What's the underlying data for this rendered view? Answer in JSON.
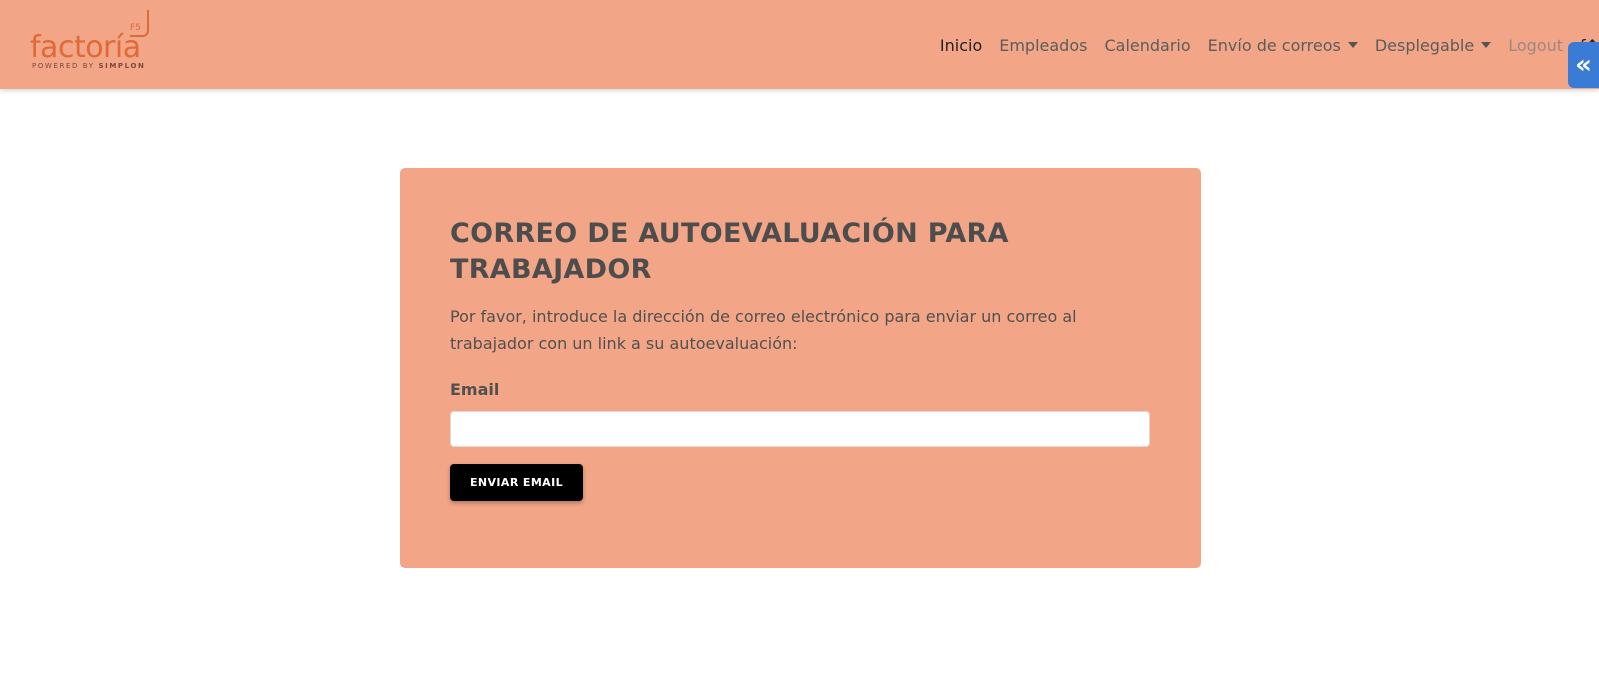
{
  "brand": {
    "name": "factoría",
    "subtitle_prefix": "POWERED BY ",
    "subtitle_emph": "SIMPLON",
    "mark": "F5",
    "color": "#e06a35"
  },
  "nav": {
    "items": [
      {
        "label": "Inicio"
      },
      {
        "label": "Empleados"
      },
      {
        "label": "Calendario"
      },
      {
        "label": "Envío de correos"
      },
      {
        "label": "Desplegable"
      },
      {
        "label": "Logout"
      }
    ],
    "cut_icon": "f↑"
  },
  "side_toggle": {
    "icon": "double-chevron-left-icon",
    "glyph": "«"
  },
  "form": {
    "title": "CORREO DE AUTOEVALUACIÓN PARA TRABAJADOR",
    "description": "Por favor, introduce la dirección de correo electrónico para enviar un correo al trabajador con un link a su autoevaluación:",
    "email_label": "Email",
    "email_value": "",
    "submit_label": "ENVIAR EMAIL"
  },
  "colors": {
    "header_bg": "#f2a687",
    "card_bg": "#f2a687",
    "button_bg": "#000000",
    "toggle_bg": "#3a7bd5"
  }
}
